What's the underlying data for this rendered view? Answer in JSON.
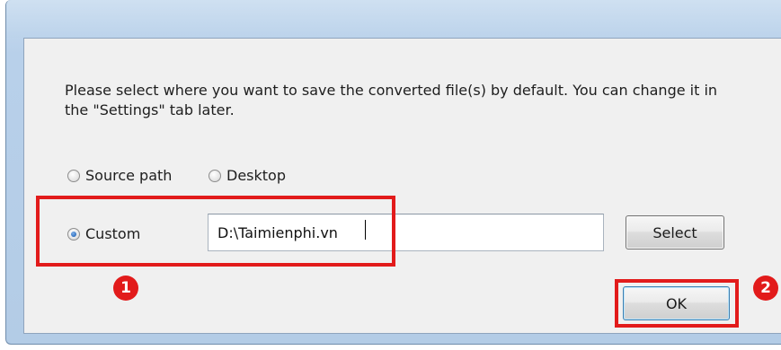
{
  "dialog": {
    "message": "Please select where you want to save the converted file(s) by default. You can change it in the \"Settings\" tab later.",
    "options": {
      "source_path": {
        "label": "Source path",
        "checked": false
      },
      "desktop": {
        "label": "Desktop",
        "checked": false
      },
      "custom": {
        "label": "Custom",
        "checked": true
      }
    },
    "path_value": "D:\\Taimienphi.vn",
    "select_label": "Select",
    "ok_label": "OK"
  },
  "annotations": {
    "marker_1": "1",
    "marker_2": "2",
    "highlight_color": "#e21b1b"
  }
}
